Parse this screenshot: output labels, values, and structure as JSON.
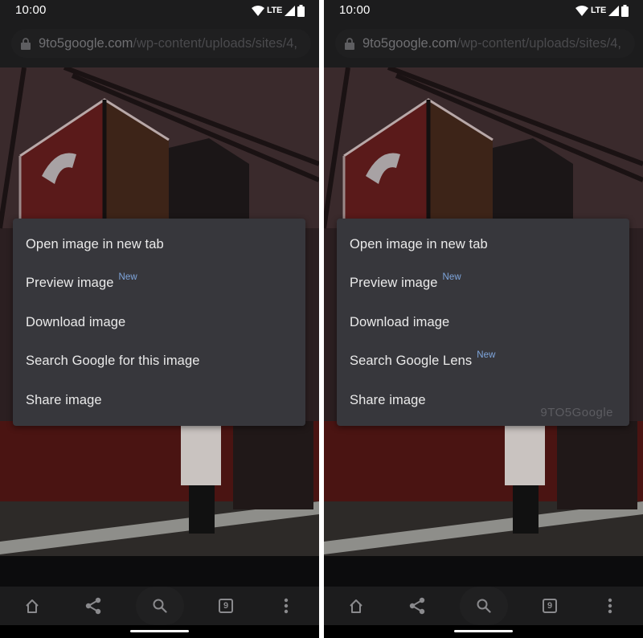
{
  "screens": [
    {
      "status_bar": {
        "time": "10:00",
        "network": "LTE",
        "icons": [
          "wifi-icon",
          "signal-icon",
          "battery-icon"
        ]
      },
      "url_bar": {
        "domain": "9to5google.com",
        "path": "/wp-content/uploads/sites/4,",
        "icon": "lock-icon"
      },
      "context_menu": {
        "items": [
          {
            "label": "Open image in new tab",
            "badge": ""
          },
          {
            "label": "Preview image",
            "badge": "New"
          },
          {
            "label": "Download image",
            "badge": ""
          },
          {
            "label": "Search Google for this image",
            "badge": ""
          },
          {
            "label": "Share image",
            "badge": ""
          }
        ],
        "watermark": ""
      },
      "toolbar": {
        "buttons": [
          {
            "name": "home",
            "icon": "home-icon"
          },
          {
            "name": "share",
            "icon": "share-icon"
          },
          {
            "name": "search",
            "icon": "search-icon"
          },
          {
            "name": "tabs",
            "icon": "tab-switcher-icon",
            "count": "9"
          },
          {
            "name": "menu",
            "icon": "more-vert-icon"
          }
        ]
      }
    },
    {
      "status_bar": {
        "time": "10:00",
        "network": "LTE",
        "icons": [
          "wifi-icon",
          "signal-icon",
          "battery-icon"
        ]
      },
      "url_bar": {
        "domain": "9to5google.com",
        "path": "/wp-content/uploads/sites/4,",
        "icon": "lock-icon"
      },
      "context_menu": {
        "items": [
          {
            "label": "Open image in new tab",
            "badge": ""
          },
          {
            "label": "Preview image",
            "badge": "New"
          },
          {
            "label": "Download image",
            "badge": ""
          },
          {
            "label": "Search Google Lens",
            "badge": "New"
          },
          {
            "label": "Share image",
            "badge": ""
          }
        ],
        "watermark": "9TO5Google"
      },
      "toolbar": {
        "buttons": [
          {
            "name": "home",
            "icon": "home-icon"
          },
          {
            "name": "share",
            "icon": "share-icon"
          },
          {
            "name": "search",
            "icon": "search-icon"
          },
          {
            "name": "tabs",
            "icon": "tab-switcher-icon",
            "count": "9"
          },
          {
            "name": "menu",
            "icon": "more-vert-icon"
          }
        ]
      }
    }
  ],
  "colors": {
    "menu_background": "#37373c",
    "menu_text": "#eaeaea",
    "badge_accent": "#7fa6dd",
    "toolbar_icon": "#8a8a8d"
  }
}
